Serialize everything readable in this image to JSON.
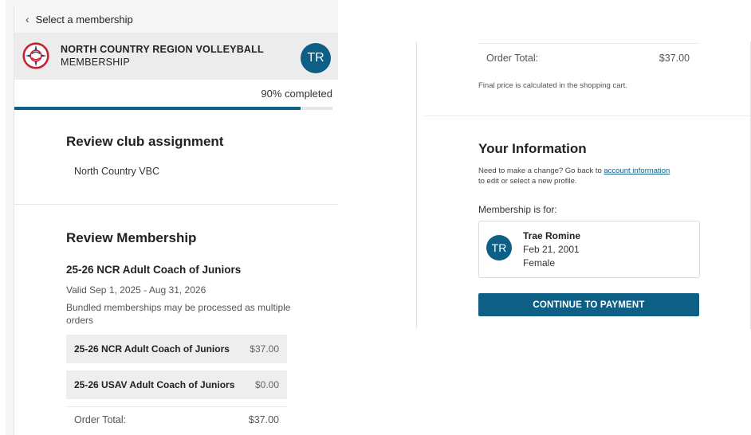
{
  "nav": {
    "back_label": "Select a membership"
  },
  "org": {
    "title_line1": "NORTH COUNTRY REGION VOLLEYBALL",
    "title_line2": "MEMBERSHIP",
    "user_initials": "TR"
  },
  "progress": {
    "label": "90% completed",
    "value": 0.9
  },
  "club_assignment": {
    "title": "Review club assignment",
    "club": "North Country VBC"
  },
  "membership": {
    "title": "Review Membership",
    "name": "25-26 NCR Adult Coach of Juniors",
    "valid": "Valid Sep 1, 2025 - Aug 31, 2026",
    "bundled_note": "Bundled memberships may be processed as multiple orders",
    "items": [
      {
        "name": "25-26 NCR Adult Coach of Juniors",
        "price": "$37.00"
      },
      {
        "name": "25-26 USAV Adult Coach of Juniors",
        "price": "$0.00"
      }
    ],
    "order_total_label": "Order Total:",
    "order_total": "$37.00"
  },
  "summary": {
    "order_total_label": "Order Total:",
    "order_total": "$37.00",
    "final_note": "Final price is calculated in the shopping cart."
  },
  "your_info": {
    "title": "Your Information",
    "change_text": "Need to make a change? Go back to",
    "change_link": "account information",
    "change_tail": "to edit or select a new profile.",
    "for_label": "Membership is for:",
    "profile": {
      "initials": "TR",
      "name": "Trae Romine",
      "dob": "Feb 21, 2001",
      "gender": "Female"
    }
  },
  "cta": {
    "label": "CONTINUE TO PAYMENT"
  },
  "colors": {
    "accent": "#0e5f86",
    "logo_red": "#c8202f",
    "logo_blue": "#1d3f77"
  }
}
